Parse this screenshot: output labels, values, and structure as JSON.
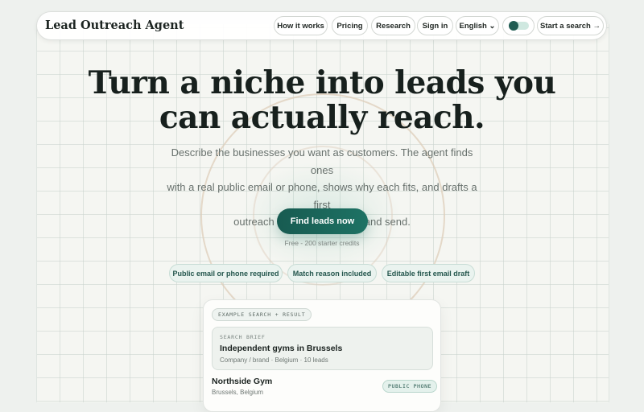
{
  "header": {
    "brand": "Lead Outreach Agent",
    "nav": {
      "how_it_works": "How it works",
      "pricing": "Pricing",
      "research": "Research",
      "sign_in": "Sign in",
      "language": "English ⌄",
      "start_search": "Start a search →"
    },
    "theme_toggle_icon": "theme-toggle-icon"
  },
  "hero": {
    "title_line1": "Turn a niche into leads you",
    "title_line2": "can actually reach.",
    "subtitle_line1": "Describe the businesses you want as customers. The agent finds ones",
    "subtitle_line2": "with a real public email or phone, shows why each fits, and drafts a first",
    "subtitle_line3": "outreach email you can edit and send.",
    "cta": "Find leads now",
    "cta_note": "Free - 200 starter credits",
    "features": [
      "Public email or phone required",
      "Match reason included",
      "Editable first email draft"
    ]
  },
  "example": {
    "tag": "EXAMPLE SEARCH + RESULT",
    "brief_label": "SEARCH BRIEF",
    "brief_title": "Independent gyms in Brussels",
    "brief_meta": "Company / brand · Belgium · 10 leads",
    "lead_name": "Northside Gym",
    "lead_location": "Brussels, Belgium",
    "lead_badge": "PUBLIC PHONE"
  },
  "colors": {
    "accent": "#1b6a5e",
    "background": "#eef1ee",
    "pill_bg": "#eaf3ef"
  }
}
